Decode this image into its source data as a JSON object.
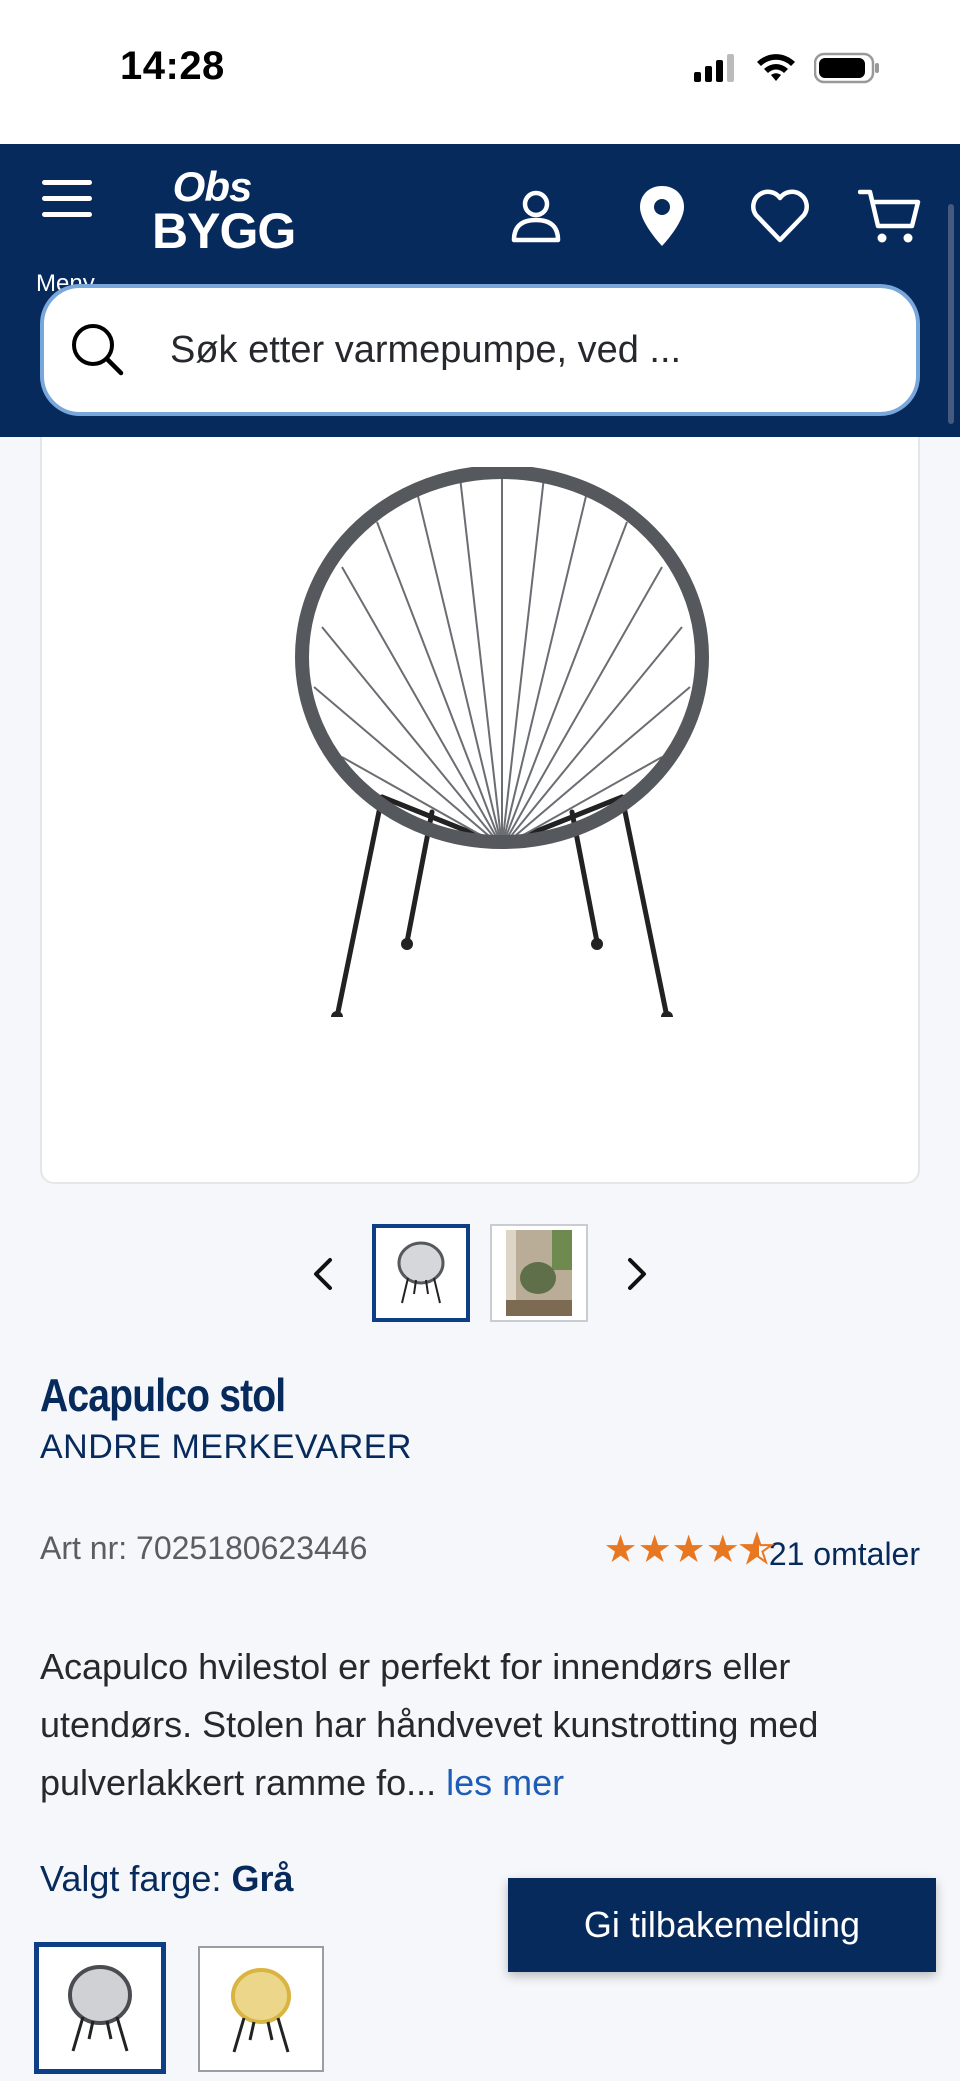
{
  "status_bar": {
    "time": "14:28"
  },
  "header": {
    "menu_label": "Meny",
    "logo_line1": "Obs",
    "logo_line2": "BYGG",
    "icons": [
      "account-icon",
      "location-icon",
      "heart-icon",
      "cart-icon"
    ]
  },
  "search": {
    "placeholder": "Søk etter varmepumpe, ved ..."
  },
  "gallery": {
    "thumbnails": [
      "chair-grey",
      "chair-lifestyle"
    ],
    "active_index": 0
  },
  "product": {
    "title": "Acapulco stol",
    "brand": "ANDRE MERKEVARER",
    "art_nr": "Art nr: 7025180623446",
    "rating": 4.5,
    "reviews_label": "21 omtaler",
    "description": "Acapulco hvilestol er perfekt for innendørs eller utendørs. Stolen har håndvevet kunstrotting med pulverlakkert ramme fo... ",
    "read_more": "les mer",
    "color_label": "Valgt farge: ",
    "color_value": "Grå",
    "colors": [
      {
        "name": "Grå",
        "hex": "#4a4c51"
      },
      {
        "name": "Gul",
        "hex": "#d9b441"
      }
    ]
  },
  "feedback_button": "Gi tilbakemelding",
  "colors": {
    "navy": "#062a5c",
    "accent_orange": "#e87722",
    "link_blue": "#1d5db8"
  }
}
